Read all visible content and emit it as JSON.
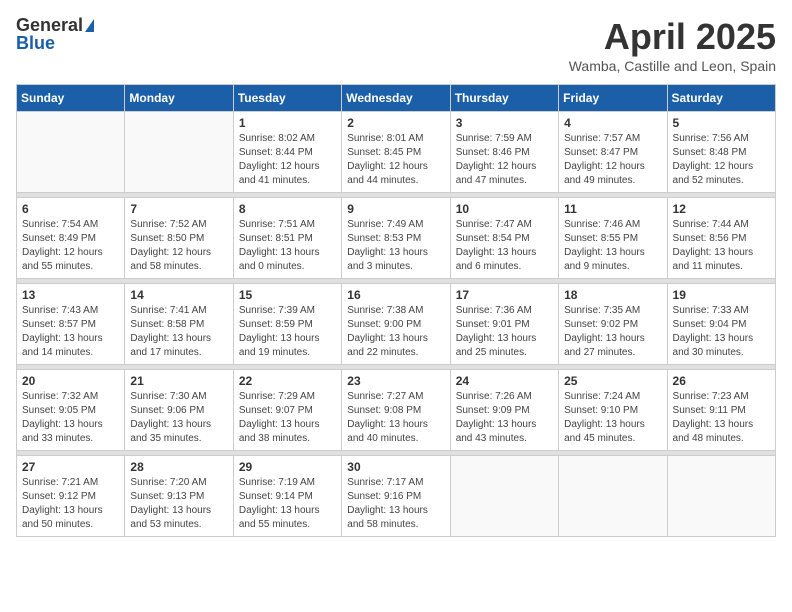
{
  "header": {
    "logo_general": "General",
    "logo_blue": "Blue",
    "month_title": "April 2025",
    "location": "Wamba, Castille and Leon, Spain"
  },
  "days_of_week": [
    "Sunday",
    "Monday",
    "Tuesday",
    "Wednesday",
    "Thursday",
    "Friday",
    "Saturday"
  ],
  "weeks": [
    {
      "days": [
        {
          "number": "",
          "content": ""
        },
        {
          "number": "",
          "content": ""
        },
        {
          "number": "1",
          "content": "Sunrise: 8:02 AM\nSunset: 8:44 PM\nDaylight: 12 hours and 41 minutes."
        },
        {
          "number": "2",
          "content": "Sunrise: 8:01 AM\nSunset: 8:45 PM\nDaylight: 12 hours and 44 minutes."
        },
        {
          "number": "3",
          "content": "Sunrise: 7:59 AM\nSunset: 8:46 PM\nDaylight: 12 hours and 47 minutes."
        },
        {
          "number": "4",
          "content": "Sunrise: 7:57 AM\nSunset: 8:47 PM\nDaylight: 12 hours and 49 minutes."
        },
        {
          "number": "5",
          "content": "Sunrise: 7:56 AM\nSunset: 8:48 PM\nDaylight: 12 hours and 52 minutes."
        }
      ]
    },
    {
      "days": [
        {
          "number": "6",
          "content": "Sunrise: 7:54 AM\nSunset: 8:49 PM\nDaylight: 12 hours and 55 minutes."
        },
        {
          "number": "7",
          "content": "Sunrise: 7:52 AM\nSunset: 8:50 PM\nDaylight: 12 hours and 58 minutes."
        },
        {
          "number": "8",
          "content": "Sunrise: 7:51 AM\nSunset: 8:51 PM\nDaylight: 13 hours and 0 minutes."
        },
        {
          "number": "9",
          "content": "Sunrise: 7:49 AM\nSunset: 8:53 PM\nDaylight: 13 hours and 3 minutes."
        },
        {
          "number": "10",
          "content": "Sunrise: 7:47 AM\nSunset: 8:54 PM\nDaylight: 13 hours and 6 minutes."
        },
        {
          "number": "11",
          "content": "Sunrise: 7:46 AM\nSunset: 8:55 PM\nDaylight: 13 hours and 9 minutes."
        },
        {
          "number": "12",
          "content": "Sunrise: 7:44 AM\nSunset: 8:56 PM\nDaylight: 13 hours and 11 minutes."
        }
      ]
    },
    {
      "days": [
        {
          "number": "13",
          "content": "Sunrise: 7:43 AM\nSunset: 8:57 PM\nDaylight: 13 hours and 14 minutes."
        },
        {
          "number": "14",
          "content": "Sunrise: 7:41 AM\nSunset: 8:58 PM\nDaylight: 13 hours and 17 minutes."
        },
        {
          "number": "15",
          "content": "Sunrise: 7:39 AM\nSunset: 8:59 PM\nDaylight: 13 hours and 19 minutes."
        },
        {
          "number": "16",
          "content": "Sunrise: 7:38 AM\nSunset: 9:00 PM\nDaylight: 13 hours and 22 minutes."
        },
        {
          "number": "17",
          "content": "Sunrise: 7:36 AM\nSunset: 9:01 PM\nDaylight: 13 hours and 25 minutes."
        },
        {
          "number": "18",
          "content": "Sunrise: 7:35 AM\nSunset: 9:02 PM\nDaylight: 13 hours and 27 minutes."
        },
        {
          "number": "19",
          "content": "Sunrise: 7:33 AM\nSunset: 9:04 PM\nDaylight: 13 hours and 30 minutes."
        }
      ]
    },
    {
      "days": [
        {
          "number": "20",
          "content": "Sunrise: 7:32 AM\nSunset: 9:05 PM\nDaylight: 13 hours and 33 minutes."
        },
        {
          "number": "21",
          "content": "Sunrise: 7:30 AM\nSunset: 9:06 PM\nDaylight: 13 hours and 35 minutes."
        },
        {
          "number": "22",
          "content": "Sunrise: 7:29 AM\nSunset: 9:07 PM\nDaylight: 13 hours and 38 minutes."
        },
        {
          "number": "23",
          "content": "Sunrise: 7:27 AM\nSunset: 9:08 PM\nDaylight: 13 hours and 40 minutes."
        },
        {
          "number": "24",
          "content": "Sunrise: 7:26 AM\nSunset: 9:09 PM\nDaylight: 13 hours and 43 minutes."
        },
        {
          "number": "25",
          "content": "Sunrise: 7:24 AM\nSunset: 9:10 PM\nDaylight: 13 hours and 45 minutes."
        },
        {
          "number": "26",
          "content": "Sunrise: 7:23 AM\nSunset: 9:11 PM\nDaylight: 13 hours and 48 minutes."
        }
      ]
    },
    {
      "days": [
        {
          "number": "27",
          "content": "Sunrise: 7:21 AM\nSunset: 9:12 PM\nDaylight: 13 hours and 50 minutes."
        },
        {
          "number": "28",
          "content": "Sunrise: 7:20 AM\nSunset: 9:13 PM\nDaylight: 13 hours and 53 minutes."
        },
        {
          "number": "29",
          "content": "Sunrise: 7:19 AM\nSunset: 9:14 PM\nDaylight: 13 hours and 55 minutes."
        },
        {
          "number": "30",
          "content": "Sunrise: 7:17 AM\nSunset: 9:16 PM\nDaylight: 13 hours and 58 minutes."
        },
        {
          "number": "",
          "content": ""
        },
        {
          "number": "",
          "content": ""
        },
        {
          "number": "",
          "content": ""
        }
      ]
    }
  ]
}
